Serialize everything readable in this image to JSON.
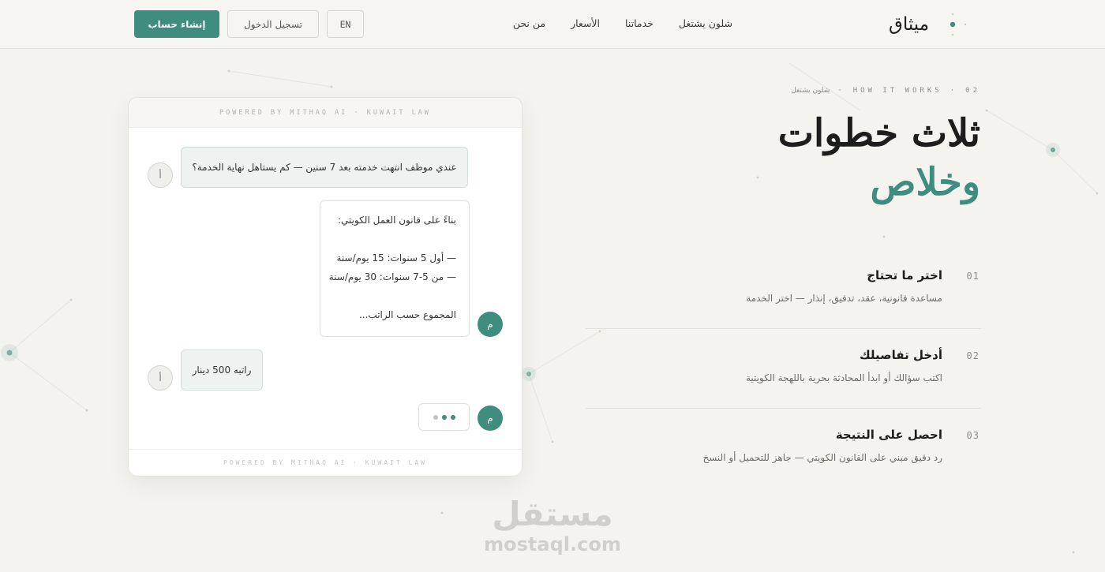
{
  "brand": {
    "name": "ميثاق",
    "accent": "#3e8d7f"
  },
  "nav": {
    "items": [
      {
        "id": "how",
        "label": "شلون يشتغل"
      },
      {
        "id": "services",
        "label": "خدماتنا"
      },
      {
        "id": "pricing",
        "label": "الأسعار"
      },
      {
        "id": "about",
        "label": "من نحن"
      }
    ],
    "lang_label": "EN",
    "login_label": "تسجيل الدخول",
    "signup_label": "إنشاء حساب"
  },
  "hero": {
    "eyebrow_num": "02",
    "eyebrow_en": "HOW IT WORKS",
    "eyebrow_ar": "شلون يشتغل",
    "headline_line1": "ثلاث خطوات",
    "headline_line2": "وخلاص"
  },
  "steps": [
    {
      "num": "01",
      "title": "اختر ما تحتاج",
      "desc": "مساعدة قانونية، عقد، تدقيق، إنذار — اختر الخدمة"
    },
    {
      "num": "02",
      "title": "أدخل تفاصيلك",
      "desc": "اكتب سؤالك أو ابدأ المحادثة بحرية باللهجة الكويتية"
    },
    {
      "num": "03",
      "title": "احصل على النتيجة",
      "desc": "رد دقيق مبني على القانون الكويتي — جاهز للتحميل أو النسخ"
    }
  ],
  "chat": {
    "header": "POWERED BY MITHAQ AI · KUWAIT LAW",
    "footer": "POWERED BY MITHAQ AI · KUWAIT LAW",
    "user_avatar": "أ",
    "bot_avatar": "م",
    "msg1": "عندي موظف انتهت خدمته بعد 7 سنين — كم يستاهل نهاية الخدمة؟",
    "msg2_lines": [
      "بناءً على قانون العمل الكويتي:",
      "",
      "— أول 5 سنوات: 15 يوم/سنة",
      "— من 5-7 سنوات: 30 يوم/سنة",
      "",
      "المجموع حسب الراتب..."
    ],
    "msg3": "راتبه 500 دينار"
  },
  "watermark": {
    "ar": "مستقل",
    "en": "mostaql.com"
  }
}
